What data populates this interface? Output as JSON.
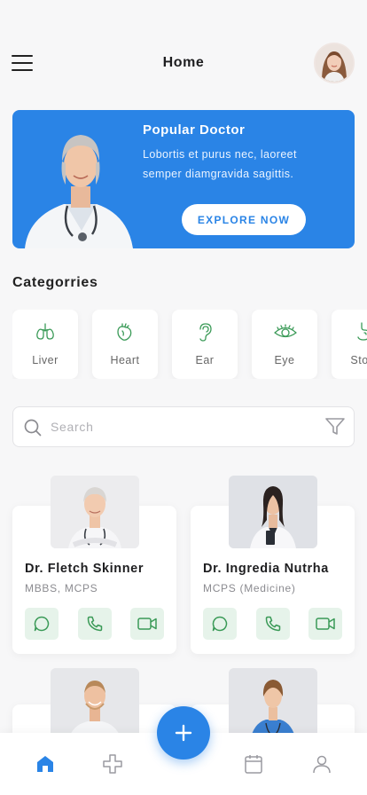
{
  "header": {
    "title": "Home",
    "menu_icon": "hamburger-menu-icon",
    "avatar_icon": "user-avatar"
  },
  "banner": {
    "title": "Popular Doctor",
    "text": "Lobortis et purus nec, laoreet semper diamgravida sagittis.",
    "button_label": "EXPLORE NOW",
    "background_color": "#2a84e6"
  },
  "categories": {
    "title": "Categorries",
    "items": [
      {
        "label": "Liver",
        "icon": "lungs-icon"
      },
      {
        "label": "Heart",
        "icon": "heart-organ-icon"
      },
      {
        "label": "Ear",
        "icon": "ear-icon"
      },
      {
        "label": "Eye",
        "icon": "eye-icon"
      },
      {
        "label": "Stom",
        "icon": "stomach-icon"
      }
    ]
  },
  "search": {
    "placeholder": "Search",
    "value": ""
  },
  "doctors": [
    {
      "name": "Dr. Fletch Skinner",
      "specialty": "MBBS, MCPS"
    },
    {
      "name": "Dr. Ingredia Nutrha",
      "specialty": "MCPS (Medicine)"
    }
  ],
  "doctor_actions": [
    "chat-icon",
    "phone-icon",
    "video-icon"
  ],
  "tabbar": {
    "items": [
      "home-icon",
      "medical-cross-icon",
      "add-icon",
      "calendar-icon",
      "profile-icon"
    ],
    "active": "home-icon"
  },
  "colors": {
    "accent": "#2a84e6",
    "action_bg": "#e6f3ea",
    "action_icon": "#3a9a57"
  }
}
